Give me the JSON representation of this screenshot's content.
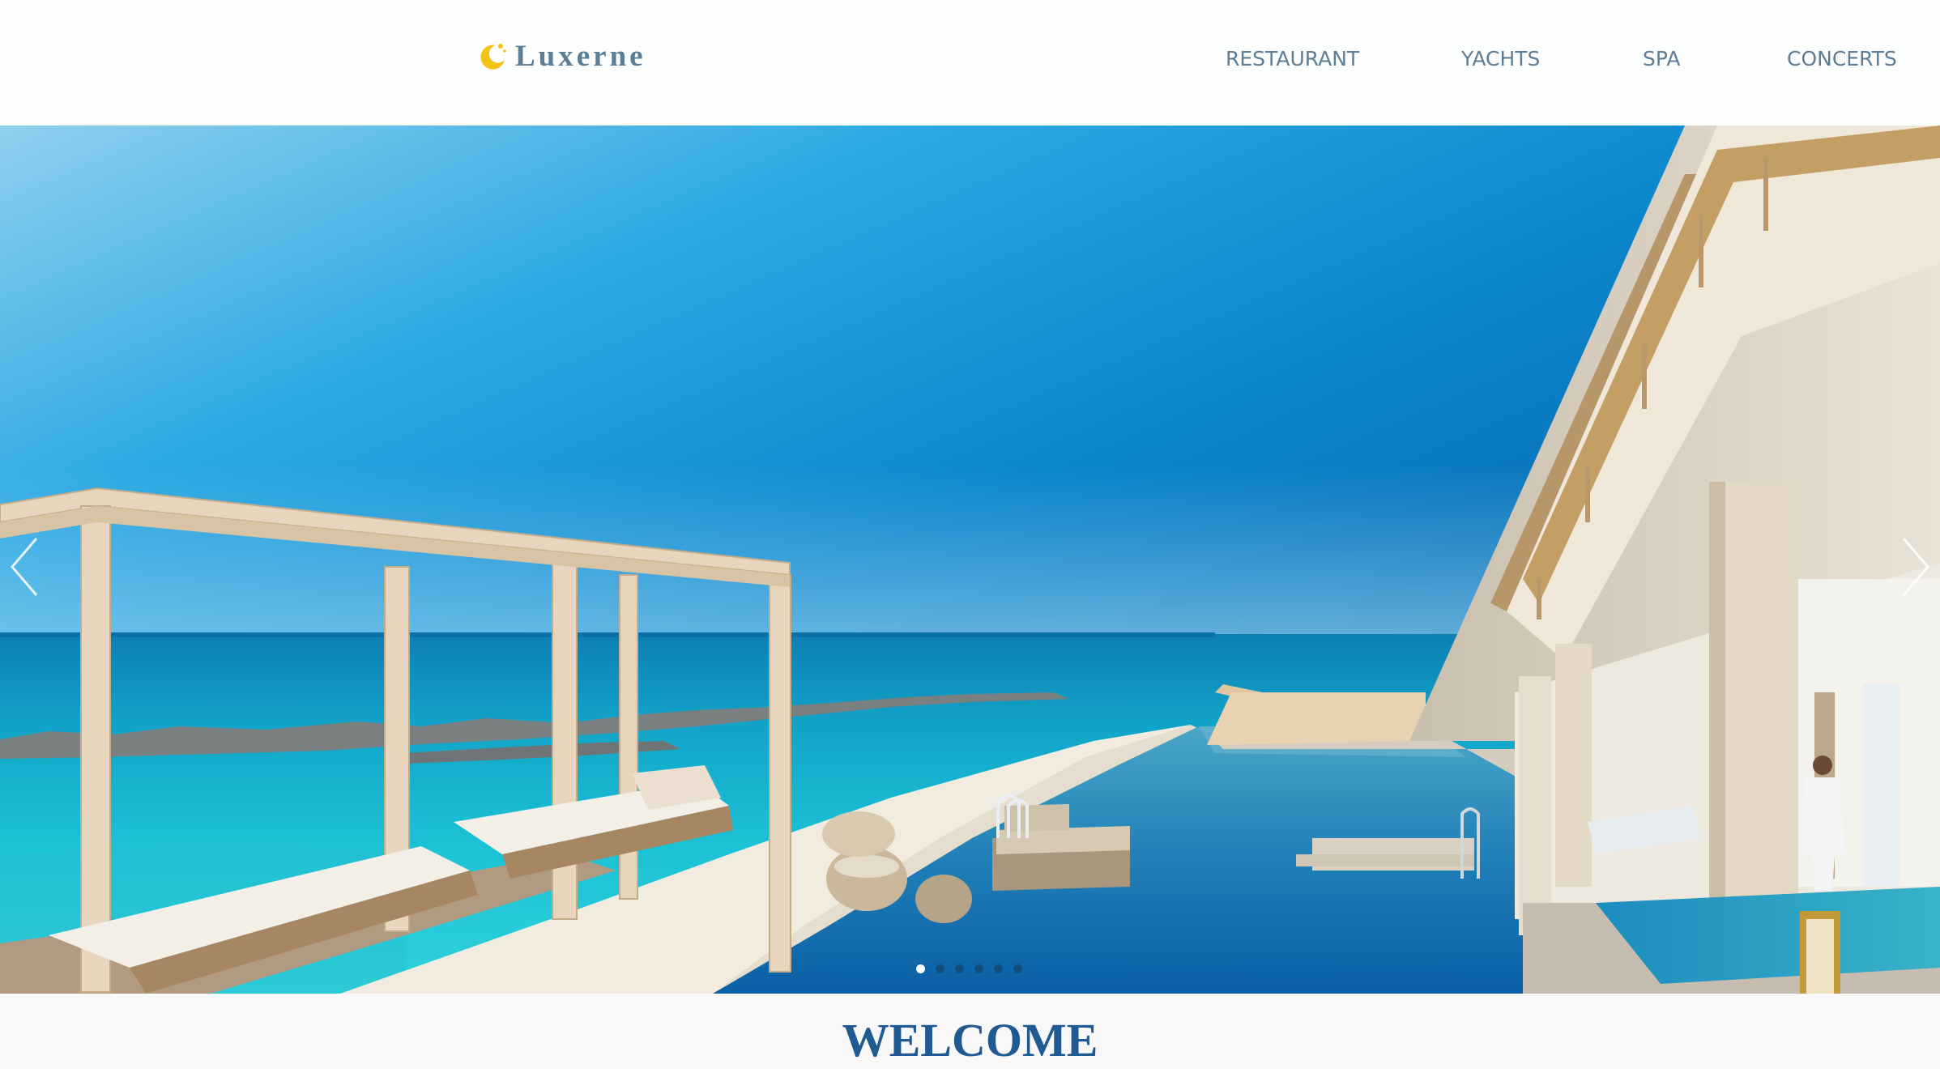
{
  "brand": {
    "name": "Luxerne",
    "icon": "moon-icon",
    "icon_color": "#f3c313"
  },
  "nav": {
    "items": [
      {
        "label": "RESTAURANT"
      },
      {
        "label": "YACHTS"
      },
      {
        "label": "SPA"
      },
      {
        "label": "CONCERTS"
      }
    ],
    "text_color": "#5e7d94"
  },
  "hero": {
    "slide_count": 6,
    "active_slide": 1,
    "prev_icon": "chevron-left-icon",
    "next_icon": "chevron-right-icon"
  },
  "welcome": {
    "title": "WELCOME",
    "color": "#1f5a93"
  }
}
